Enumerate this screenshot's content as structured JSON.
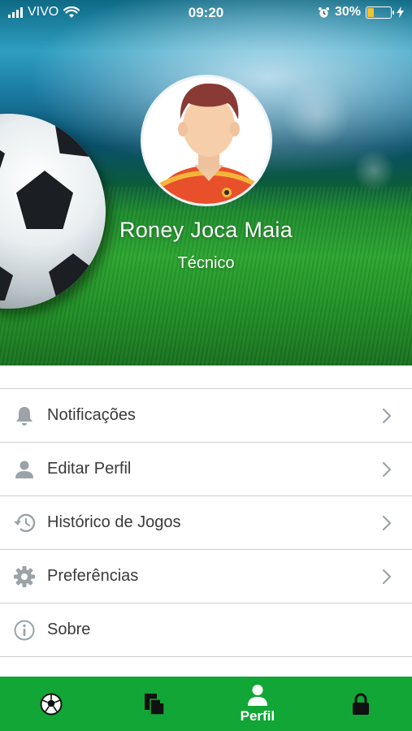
{
  "status_bar": {
    "carrier": "VIVO",
    "time": "09:20",
    "battery_percent": "30%",
    "battery_level": 0.3,
    "icons": [
      "signal-icon",
      "wifi-icon",
      "alarm-icon",
      "battery-icon",
      "charging-icon"
    ]
  },
  "profile": {
    "name": "Roney Joca Maia",
    "role": "Técnico",
    "avatar_icon": "user-avatar-icon"
  },
  "menu": {
    "items": [
      {
        "label": "Notificações",
        "icon": "bell-icon",
        "has_chevron": true
      },
      {
        "label": "Editar Perfil",
        "icon": "person-icon",
        "has_chevron": true
      },
      {
        "label": "Histórico de Jogos",
        "icon": "history-icon",
        "has_chevron": true
      },
      {
        "label": "Preferências",
        "icon": "gear-icon",
        "has_chevron": true
      },
      {
        "label": "Sobre",
        "icon": "info-icon",
        "has_chevron": false
      }
    ]
  },
  "tab_bar": {
    "tabs": [
      {
        "icon": "soccer-ball-icon",
        "label": "",
        "active": false
      },
      {
        "icon": "documents-icon",
        "label": "",
        "active": false
      },
      {
        "icon": "person-icon",
        "label": "Perfil",
        "active": true
      },
      {
        "icon": "lock-icon",
        "label": "",
        "active": false
      }
    ]
  },
  "colors": {
    "tab_bar_bg": "#12a636",
    "menu_icon": "#9aa3a8",
    "menu_text": "#3a3a3a",
    "divider": "#cfcfcf",
    "battery_fill": "#f2c230"
  }
}
